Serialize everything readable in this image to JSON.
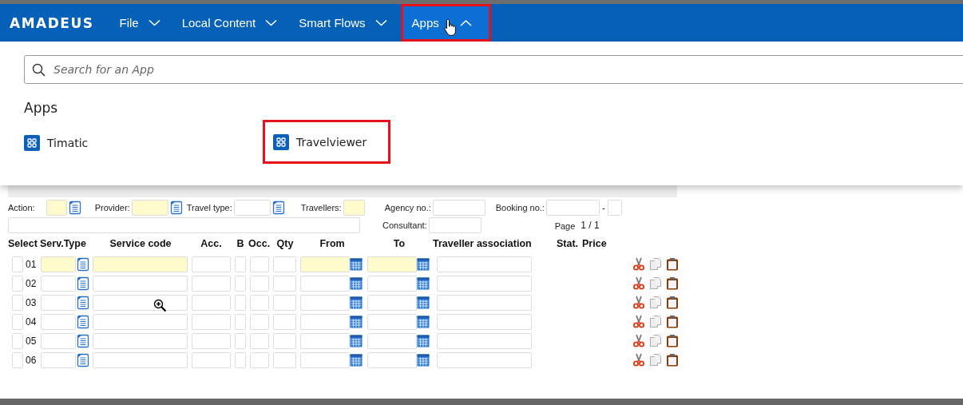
{
  "nav": {
    "logo": "AMADEUS",
    "items": [
      {
        "label": "File",
        "expanded": false,
        "highlighted": false
      },
      {
        "label": "Local Content",
        "expanded": false,
        "highlighted": false
      },
      {
        "label": "Smart Flows",
        "expanded": false,
        "highlighted": false
      },
      {
        "label": "Apps",
        "expanded": true,
        "highlighted": true
      }
    ]
  },
  "apps_menu": {
    "search": {
      "placeholder": "Search for an App"
    },
    "heading": "Apps",
    "items": [
      {
        "label": "Timatic",
        "highlighted": false
      },
      {
        "label": "Travelviewer",
        "highlighted": true
      }
    ]
  },
  "form": {
    "fields_row_1": [
      {
        "label": "Action:",
        "kind": "lookup",
        "required": true
      },
      {
        "label": "Provider:",
        "kind": "lookup",
        "required": true
      },
      {
        "label": "Travel type:",
        "kind": "lookup",
        "required": false
      },
      {
        "label": "Travellers:",
        "kind": "text",
        "required": true
      },
      {
        "label": "Agency no.:",
        "kind": "text",
        "required": false
      },
      {
        "label": "Booking no.:",
        "kind": "booking",
        "required": false,
        "separator": "-"
      }
    ],
    "consultant_label": "Consultant:",
    "page_label": "Page",
    "page_of": "1 / 1"
  },
  "table": {
    "columns": [
      "Select",
      "Serv.Type",
      "Service code",
      "Acc.",
      "B",
      "Occ.",
      "Qty",
      "From",
      "To",
      "Traveller association",
      "Stat.",
      "Price"
    ],
    "rows": [
      {
        "number": "01",
        "selected": false,
        "required": true
      },
      {
        "number": "02",
        "selected": false,
        "required": false
      },
      {
        "number": "03",
        "selected": false,
        "required": false
      },
      {
        "number": "04",
        "selected": false,
        "required": false
      },
      {
        "number": "05",
        "selected": false,
        "required": false
      },
      {
        "number": "06",
        "selected": false,
        "required": false
      }
    ]
  }
}
